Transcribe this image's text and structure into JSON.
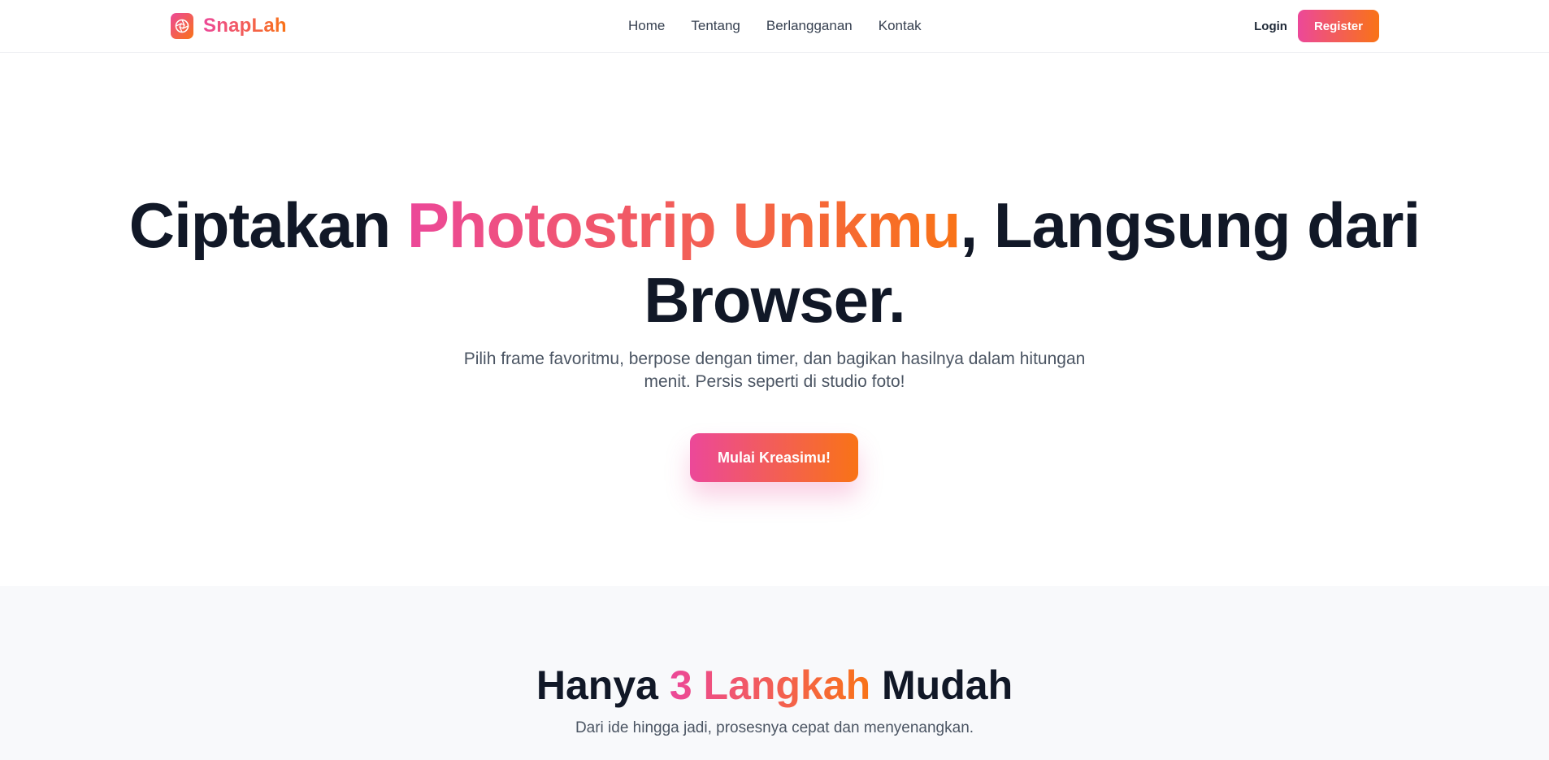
{
  "navbar": {
    "brand_name": "SnapLah",
    "links": [
      "Home",
      "Tentang",
      "Berlangganan",
      "Kontak"
    ],
    "login_label": "Login",
    "register_label": "Register"
  },
  "hero": {
    "title_part1": "Ciptakan ",
    "title_highlight": "Photostrip Unikmu",
    "title_part2": ", Langsung dari Browser.",
    "subtitle": "Pilih frame favoritmu, berpose dengan timer, dan bagikan hasilnya dalam hitungan menit. Persis seperti di studio foto!",
    "cta_label": "Mulai Kreasimu!"
  },
  "steps": {
    "title_part1": "Hanya ",
    "title_highlight": "3 Langkah",
    "title_part2": " Mudah",
    "subtitle": "Dari ide hingga jadi, prosesnya cepat dan menyenangkan."
  },
  "colors": {
    "gradient_start": "#ec4899",
    "gradient_end": "#f97316",
    "heading": "#111827",
    "body_text": "#4b5563"
  },
  "icons": {
    "brand": "camera-aperture-icon"
  }
}
